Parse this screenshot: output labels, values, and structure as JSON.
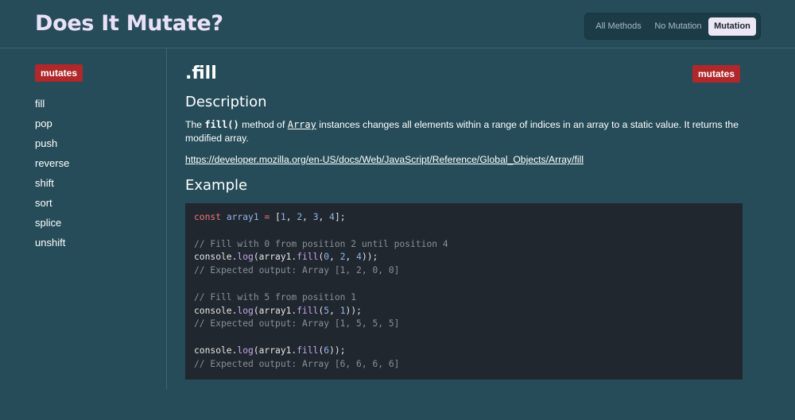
{
  "header": {
    "title": "Does It Mutate?",
    "filters": [
      "All Methods",
      "No Mutation",
      "Mutation"
    ],
    "active_filter": "Mutation"
  },
  "sidebar": {
    "badge": "mutates",
    "items": [
      "fill",
      "pop",
      "push",
      "reverse",
      "shift",
      "sort",
      "splice",
      "unshift"
    ]
  },
  "main": {
    "method_name": ".fill",
    "badge": "mutates",
    "description_heading": "Description",
    "description": {
      "prefix": "The ",
      "fn_name": "fill()",
      "mid": " method of ",
      "link_text": "Array",
      "suffix": " instances changes all elements within a range of indices in an array to a static value. It returns the modified array."
    },
    "mdn_url": "https://developer.mozilla.org/en-US/docs/Web/JavaScript/Reference/Global_Objects/Array/fill",
    "example_heading": "Example",
    "code": {
      "line1_kw": "const",
      "line1_var": "array1",
      "line1_op": "=",
      "line1_rest_open": "[",
      "line1_nums": [
        "1",
        "2",
        "3",
        "4"
      ],
      "line1_rest_close": "];",
      "comment1": "// Fill with 0 from position 2 until position 4",
      "call1_args": [
        "0",
        "2",
        "4"
      ],
      "output1": "// Expected output: Array [1, 2, 0, 0]",
      "comment2": "// Fill with 5 from position 1",
      "call2_args": [
        "5",
        "1"
      ],
      "output2": "// Expected output: Array [1, 5, 5, 5]",
      "call3_args": [
        "6"
      ],
      "output3": "// Expected output: Array [6, 6, 6, 6]",
      "console": "console",
      "log": "log",
      "fill": "fill"
    }
  },
  "colors": {
    "background": "#264c59",
    "badge": "#b0282a",
    "title": "#e9e1f7",
    "code_background": "#21272e"
  }
}
